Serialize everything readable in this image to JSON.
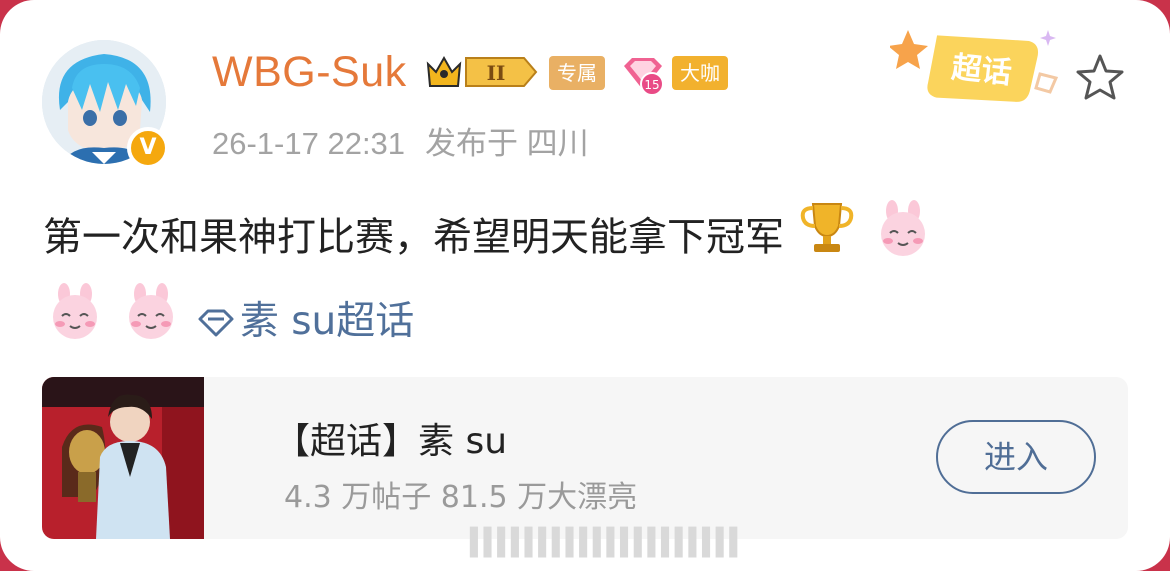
{
  "post": {
    "username": "WBG-Suk",
    "crown_level": "II",
    "tags": {
      "exclusive": "专属",
      "fan_level": "15",
      "big_shot": "大咖"
    },
    "verified_mark": "V",
    "timestamp": "26-1-17 22:31",
    "location": "发布于 四川",
    "supertopic_sticker": "超话",
    "text": "第一次和果神打比赛，希望明天能拿下冠军",
    "emojis": [
      "trophy",
      "rabbit",
      "rabbit",
      "rabbit"
    ],
    "topic_link": "素 su超话"
  },
  "topic_card": {
    "title": "【超话】素 su",
    "stats": "4.3 万帖子 81.5 万大漂亮",
    "enter_label": "进入"
  },
  "colors": {
    "username": "#e5793a",
    "link": "#50709a",
    "meta": "#a3a3a3",
    "background_edge": "#c9324a"
  }
}
